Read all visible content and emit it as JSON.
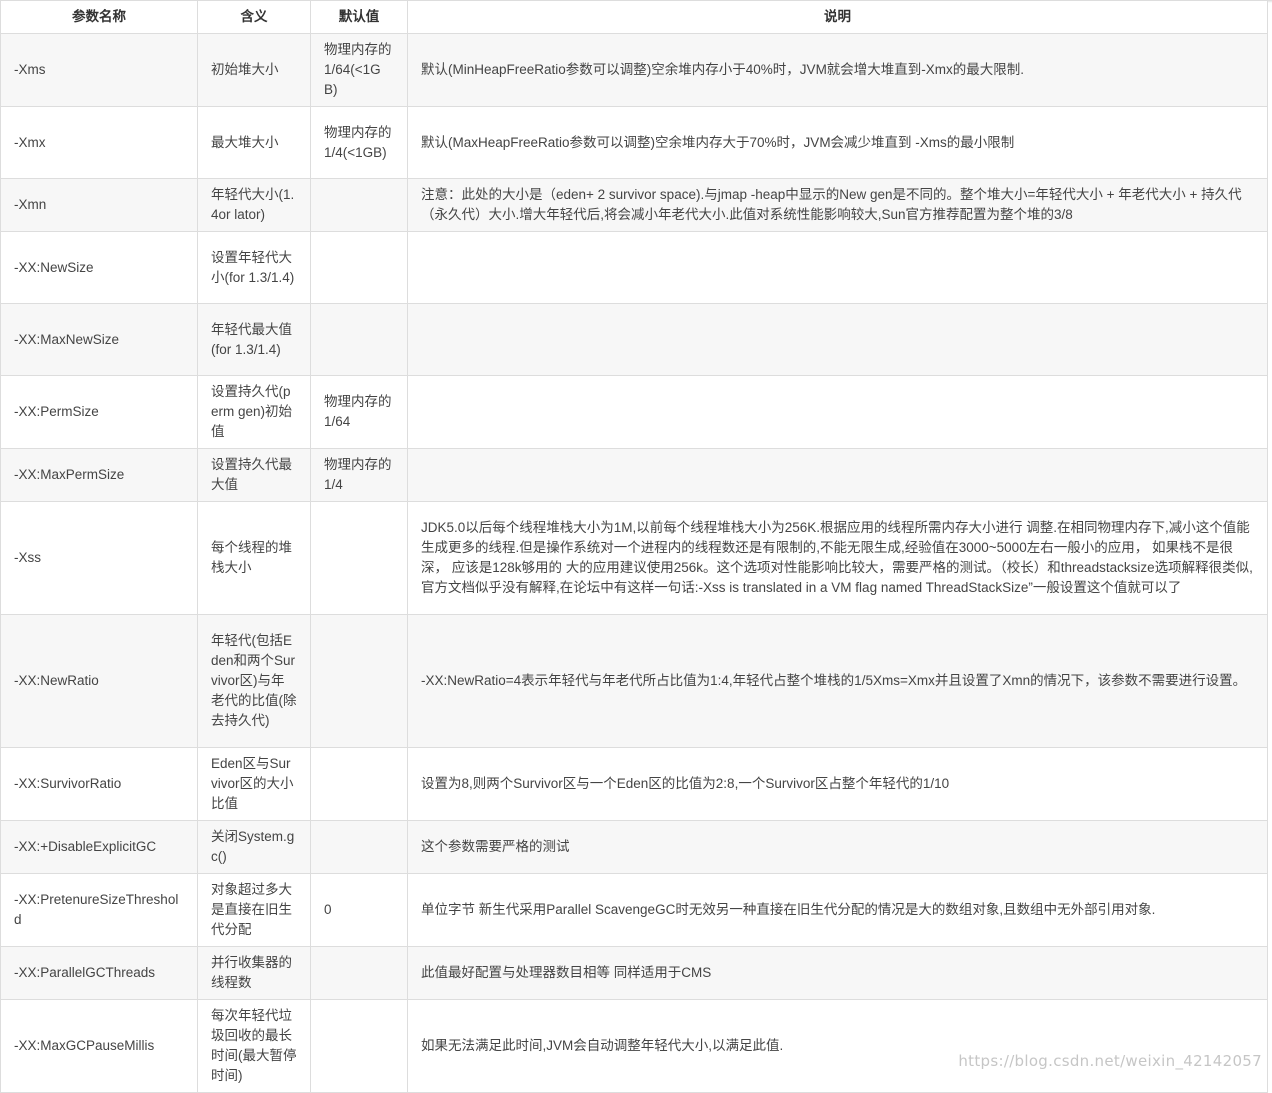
{
  "table": {
    "headers": [
      "参数名称",
      "含义",
      "默认值",
      "说明"
    ],
    "rows": [
      {
        "name": "-Xms",
        "meaning": "初始堆大小",
        "default": "物理内存的1/64(<1GB)",
        "desc": "默认(MinHeapFreeRatio参数可以调整)空余堆内存小于40%时，JVM就会增大堆直到-Xmx的最大限制."
      },
      {
        "name": "-Xmx",
        "meaning": "最大堆大小",
        "default": "物理内存的1/4(<1GB)",
        "desc": "默认(MaxHeapFreeRatio参数可以调整)空余堆内存大于70%时，JVM会减少堆直到 -Xms的最小限制"
      },
      {
        "name": "-Xmn",
        "meaning": "年轻代大小(1.4or lator)",
        "default": "",
        "desc": "注意：此处的大小是（eden+ 2 survivor space).与jmap -heap中显示的New gen是不同的。整个堆大小=年轻代大小 + 年老代大小 + 持久代（永久代）大小.增大年轻代后,将会减小年老代大小.此值对系统性能影响较大,Sun官方推荐配置为整个堆的3/8"
      },
      {
        "name": "-XX:NewSize",
        "meaning": "设置年轻代大小(for 1.3/1.4)",
        "default": "",
        "desc": ""
      },
      {
        "name": "-XX:MaxNewSize",
        "meaning": "年轻代最大值(for 1.3/1.4)",
        "default": "",
        "desc": ""
      },
      {
        "name": "-XX:PermSize",
        "meaning": "设置持久代(perm gen)初始值",
        "default": "物理内存的1/64",
        "desc": ""
      },
      {
        "name": "-XX:MaxPermSize",
        "meaning": "设置持久代最大值",
        "default": "物理内存的1/4",
        "desc": ""
      },
      {
        "name": "-Xss",
        "meaning": "每个线程的堆栈大小",
        "default": "",
        "desc": "JDK5.0以后每个线程堆栈大小为1M,以前每个线程堆栈大小为256K.根据应用的线程所需内存大小进行 调整.在相同物理内存下,减小这个值能生成更多的线程.但是操作系统对一个进程内的线程数还是有限制的,不能无限生成,经验值在3000~5000左右一般小的应用， 如果栈不是很深， 应该是128k够用的 大的应用建议使用256k。这个选项对性能影响比较大，需要严格的测试。（校长）和threadstacksize选项解释很类似,官方文档似乎没有解释,在论坛中有这样一句话:-Xss is translated in a VM flag named ThreadStackSize”一般设置这个值就可以了"
      },
      {
        "name": "-XX:NewRatio",
        "meaning": "年轻代(包括Eden和两个Survivor区)与年老代的比值(除去持久代)",
        "default": "",
        "desc": "-XX:NewRatio=4表示年轻代与年老代所占比值为1:4,年轻代占整个堆栈的1/5Xms=Xmx并且设置了Xmn的情况下，该参数不需要进行设置。"
      },
      {
        "name": "-XX:SurvivorRatio",
        "meaning": "Eden区与Survivor区的大小比值",
        "default": "",
        "desc": "设置为8,则两个Survivor区与一个Eden区的比值为2:8,一个Survivor区占整个年轻代的1/10"
      },
      {
        "name": "-XX:+DisableExplicitGC",
        "meaning": "关闭System.gc()",
        "default": "",
        "desc": "这个参数需要严格的测试"
      },
      {
        "name": "-XX:PretenureSizeThreshold",
        "meaning": "对象超过多大是直接在旧生代分配",
        "default": "0",
        "desc": "单位字节 新生代采用Parallel ScavengeGC时无效另一种直接在旧生代分配的情况是大的数组对象,且数组中无外部引用对象."
      },
      {
        "name": "-XX:ParallelGCThreads",
        "meaning": "并行收集器的线程数",
        "default": "",
        "desc": "此值最好配置与处理器数目相等 同样适用于CMS"
      },
      {
        "name": "-XX:MaxGCPauseMillis",
        "meaning": "每次年轻代垃圾回收的最长时间(最大暂停时间)",
        "default": "",
        "desc": "如果无法满足此时间,JVM会自动调整年轻代大小,以满足此值."
      }
    ]
  },
  "watermark": "https://blog.csdn.net/weixin_42142057"
}
